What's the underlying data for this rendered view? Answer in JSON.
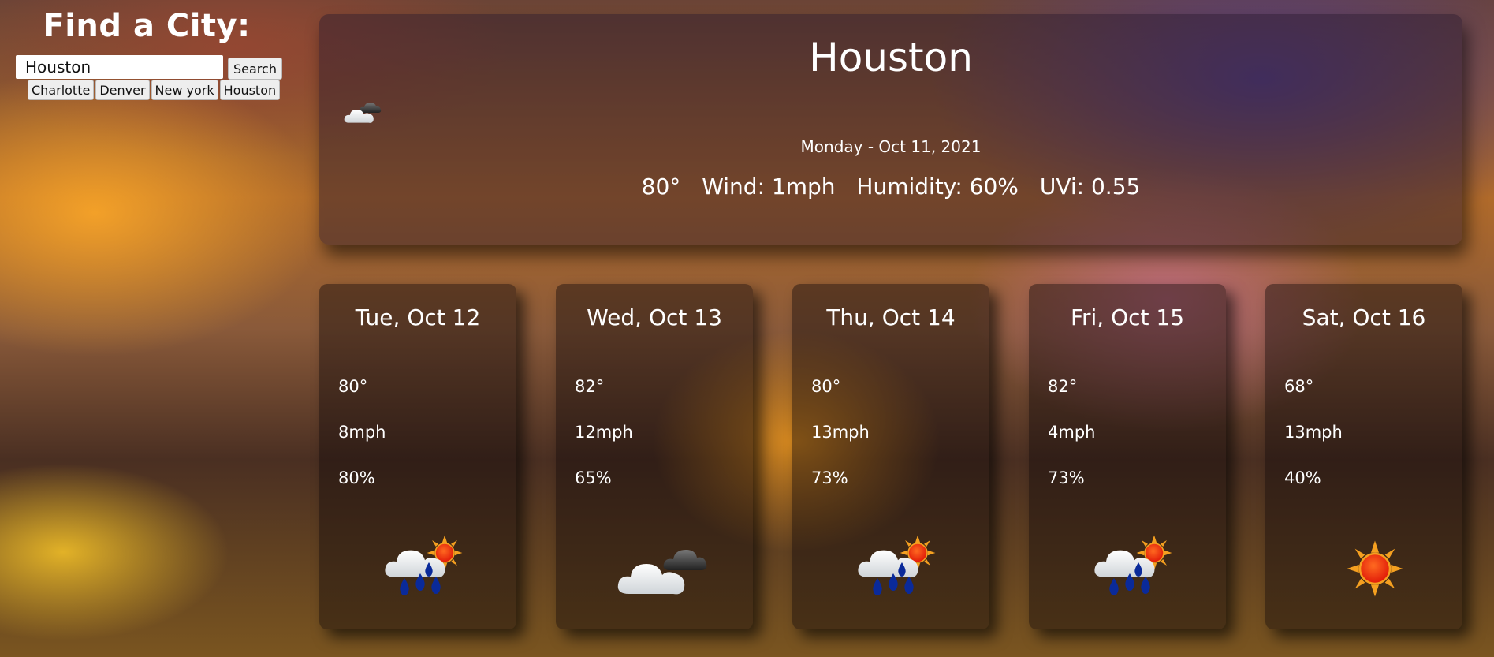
{
  "sidebar": {
    "heading": "Find a City:",
    "search_value": "Houston",
    "search_button": "Search",
    "history": [
      "Charlotte",
      "Denver",
      "New york",
      "Houston"
    ]
  },
  "current": {
    "city": "Houston",
    "icon": "partly-cloudy-icon",
    "date": "Monday - Oct 11, 2021",
    "temp": "80°",
    "wind": "Wind: 1mph",
    "humidity": "Humidity: 60%",
    "uvi": "UVi: 0.55"
  },
  "forecast": [
    {
      "day": "Tue, Oct 12",
      "temp": "80°",
      "wind": "8mph",
      "humidity": "80%",
      "icon": "rain-sun-icon"
    },
    {
      "day": "Wed, Oct 13",
      "temp": "82°",
      "wind": "12mph",
      "humidity": "65%",
      "icon": "cloudy-icon"
    },
    {
      "day": "Thu, Oct 14",
      "temp": "80°",
      "wind": "13mph",
      "humidity": "73%",
      "icon": "rain-sun-icon"
    },
    {
      "day": "Fri, Oct 15",
      "temp": "82°",
      "wind": "4mph",
      "humidity": "73%",
      "icon": "rain-sun-icon"
    },
    {
      "day": "Sat, Oct 16",
      "temp": "68°",
      "wind": "13mph",
      "humidity": "40%",
      "icon": "sun-icon"
    }
  ],
  "colors": {
    "card_bg": "#2a1a1a",
    "sun": "#f03a10",
    "sun_rays": "#f5a020",
    "rain": "#0a2a9a"
  }
}
